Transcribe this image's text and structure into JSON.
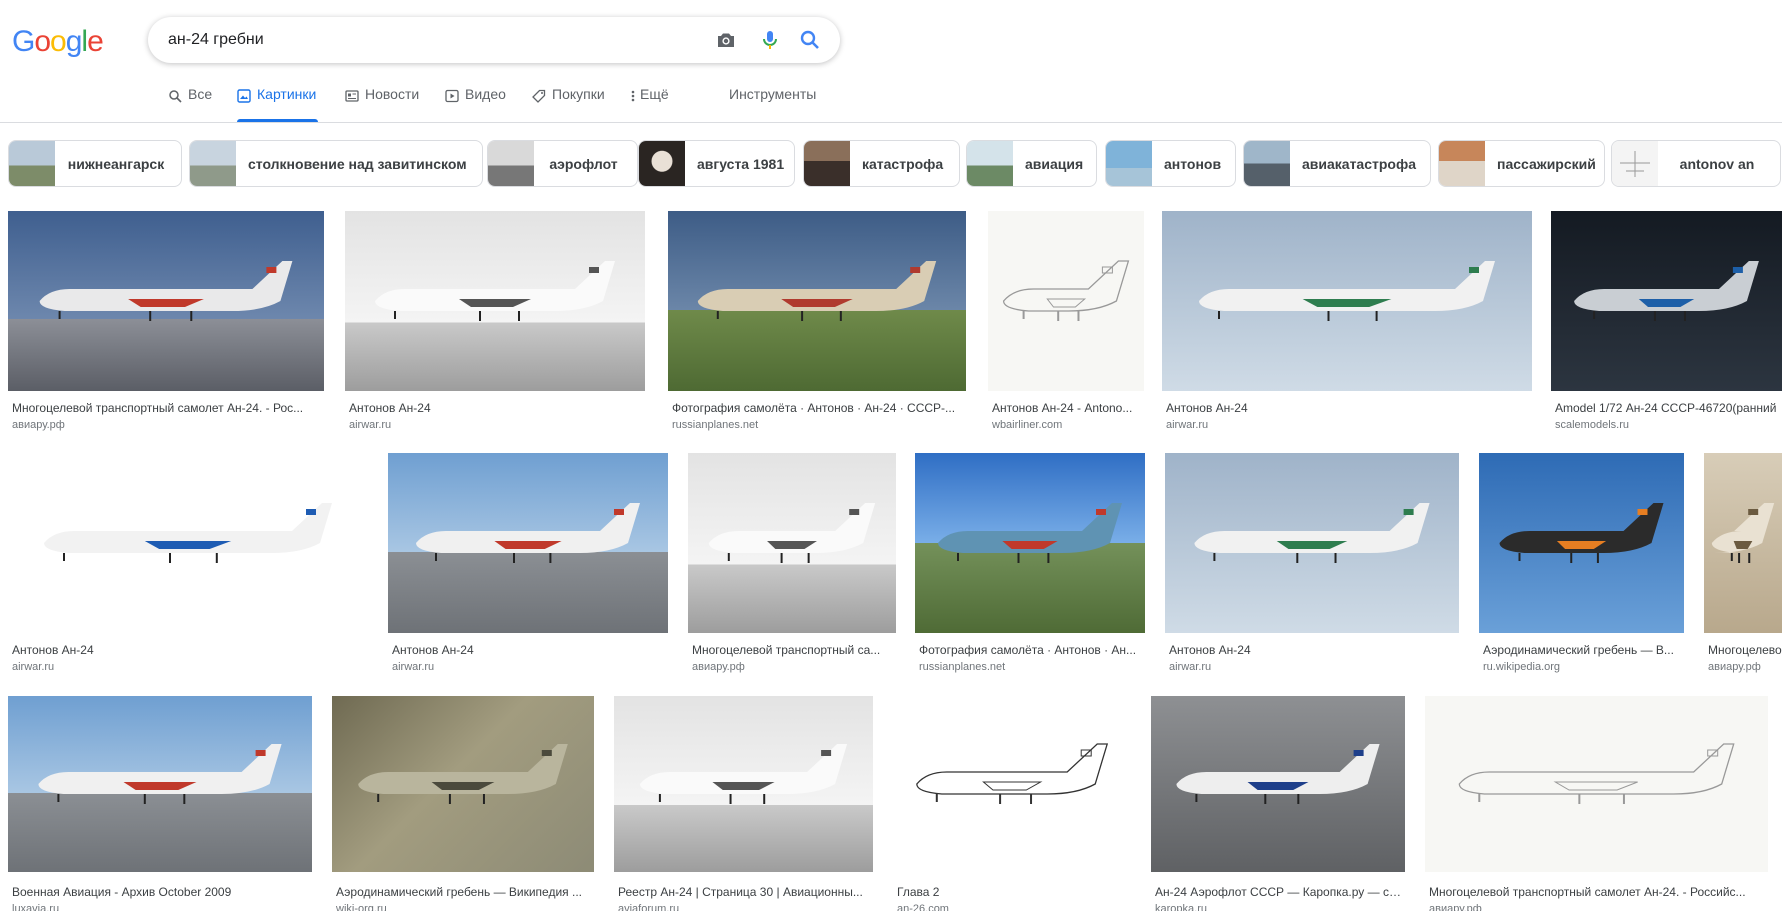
{
  "logo": {
    "letters": [
      "G",
      "o",
      "o",
      "g",
      "l",
      "e"
    ],
    "colors": [
      "#4285F4",
      "#EA4335",
      "#FBBC05",
      "#4285F4",
      "#34A853",
      "#EA4335"
    ]
  },
  "search": {
    "query": "ан-24 гребни",
    "camera_icon": "camera-icon",
    "mic_icon": "microphone-icon",
    "search_icon": "search-icon"
  },
  "tabs": [
    {
      "label": "Все",
      "icon": "search-icon",
      "active": false
    },
    {
      "label": "Картинки",
      "icon": "image-icon",
      "active": true
    },
    {
      "label": "Новости",
      "icon": "news-icon",
      "active": false
    },
    {
      "label": "Видео",
      "icon": "video-icon",
      "active": false
    },
    {
      "label": "Покупки",
      "icon": "tag-icon",
      "active": false
    },
    {
      "label": "Ещё",
      "icon": "more-vert-icon",
      "active": false
    }
  ],
  "tools_label": "Инструменты",
  "chips": [
    {
      "label": "нижнеангарск"
    },
    {
      "label": "столкновение над завитинском"
    },
    {
      "label": "аэрофлот"
    },
    {
      "label": "августа 1981"
    },
    {
      "label": "катастрофа"
    },
    {
      "label": "авиация"
    },
    {
      "label": "антонов"
    },
    {
      "label": "авиакатастрофа"
    },
    {
      "label": "пассажирский"
    },
    {
      "label": "antonov an"
    }
  ],
  "results": [
    {
      "title": "Многоцелевой транспортный самолет Ан-24. - Рос...",
      "source": "авиару.рф",
      "style": "photo-blue"
    },
    {
      "title": "Антонов Ан-24",
      "source": "airwar.ru",
      "style": "bw"
    },
    {
      "title": "Фотография самолёта · Антонов · Ан-24 · СССР-...",
      "source": "russianplanes.net",
      "style": "photo-field"
    },
    {
      "title": "Антонов Ан-24 - Antono...",
      "source": "wbairliner.com",
      "style": "drawing"
    },
    {
      "title": "Антонов Ан-24",
      "source": "airwar.ru",
      "style": "photo-sky"
    },
    {
      "title": "Amodel 1/72 Ан-24 СССР-46720(ранний",
      "source": "scalemodels.ru",
      "style": "dark"
    },
    {
      "title": "Антонов Ан-24",
      "source": "airwar.ru",
      "style": "profile"
    },
    {
      "title": "Антонов Ан-24",
      "source": "airwar.ru",
      "style": "photo-airport"
    },
    {
      "title": "Многоцелевой транспортный са...",
      "source": "авиару.рф",
      "style": "bw"
    },
    {
      "title": "Фотография самолёта · Антонов · Ан...",
      "source": "russianplanes.net",
      "style": "photo-grass"
    },
    {
      "title": "Антонов Ан-24",
      "source": "airwar.ru",
      "style": "photo-sky"
    },
    {
      "title": "Аэродинамический гребень — В...",
      "source": "ru.wikipedia.org",
      "style": "fighter"
    },
    {
      "title": "Многоцелево...",
      "source": "авиару.рф",
      "style": "sepia"
    },
    {
      "title": "Военная Авиация - Архив October 2009",
      "source": "luxavia.ru",
      "style": "photo-airport"
    },
    {
      "title": "Аэродинамический гребень — Википедия ...",
      "source": "wiki-org.ru",
      "style": "closeup"
    },
    {
      "title": "Реестр Ан-24 | Страница 30 | Авиационны...",
      "source": "aviaforum.ru",
      "style": "bw"
    },
    {
      "title": "Глава 2",
      "source": "an-26.com",
      "style": "sketch"
    },
    {
      "title": "Ан-24 Аэрофлот СССР — Каропка.ру — ст...",
      "source": "karopka.ru",
      "style": "grey-top"
    },
    {
      "title": "Многоцелевой транспортный самолет Ан-24. - Российс...",
      "source": "авиару.рф",
      "style": "drawing"
    }
  ],
  "colors": {
    "accent": "#1a73e8",
    "text_secondary": "#5f6368",
    "border": "#dadce0"
  }
}
